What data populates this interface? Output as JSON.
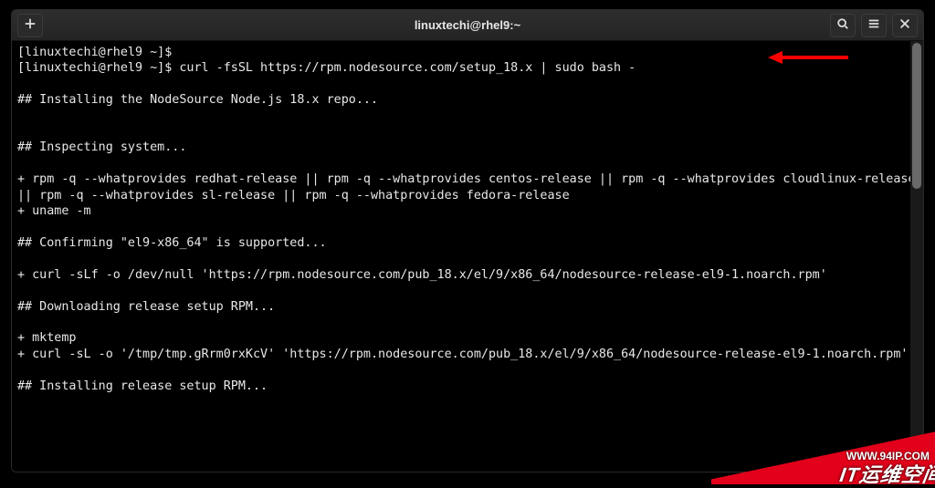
{
  "colors": {
    "accent_red": "#e2001a",
    "terminal_bg": "#000000",
    "terminal_fg": "#e8e8e8",
    "titlebar_bg": "#2a2a2a"
  },
  "titlebar": {
    "title": "linuxtechi@rhel9:~",
    "new_tab_icon": "plus-icon",
    "search_icon": "search-icon",
    "menu_icon": "hamburger-icon",
    "close_icon": "close-icon"
  },
  "terminal": {
    "lines": [
      "[linuxtechi@rhel9 ~]$",
      "[linuxtechi@rhel9 ~]$ curl -fsSL https://rpm.nodesource.com/setup_18.x | sudo bash -",
      "",
      "## Installing the NodeSource Node.js 18.x repo...",
      "",
      "",
      "## Inspecting system...",
      "",
      "+ rpm -q --whatprovides redhat-release || rpm -q --whatprovides centos-release || rpm -q --whatprovides cloudlinux-release || rpm -q --whatprovides sl-release || rpm -q --whatprovides fedora-release",
      "+ uname -m",
      "",
      "## Confirming \"el9-x86_64\" is supported...",
      "",
      "+ curl -sLf -o /dev/null 'https://rpm.nodesource.com/pub_18.x/el/9/x86_64/nodesource-release-el9-1.noarch.rpm'",
      "",
      "## Downloading release setup RPM...",
      "",
      "+ mktemp",
      "+ curl -sL -o '/tmp/tmp.gRrm0rxKcV' 'https://rpm.nodesource.com/pub_18.x/el/9/x86_64/nodesource-release-el9-1.noarch.rpm'",
      "",
      "## Installing release setup RPM..."
    ]
  },
  "annotation": {
    "arrow_color": "#ff0000"
  },
  "watermarks": {
    "url": "WWW.94IP.COM",
    "brand": "IT运维空间"
  }
}
